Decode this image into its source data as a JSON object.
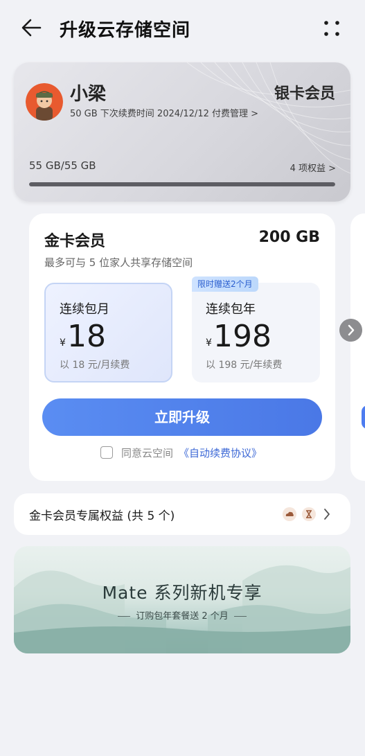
{
  "header": {
    "title": "升级云存储空间"
  },
  "member": {
    "name": "小梁",
    "tier": "银卡会员",
    "renew_info": "50 GB 下次续费时间 2024/12/12 付费管理 >",
    "usage": "55 GB/55 GB",
    "usage_fraction": 1.0,
    "benefits_link": "4 项权益 >"
  },
  "plan": {
    "title": "金卡会员",
    "size": "200 GB",
    "subtitle": "最多可与 5 位家人共享存储空间",
    "options": [
      {
        "name": "连续包月",
        "currency": "¥",
        "price": "18",
        "note": "以 18 元/月续费",
        "selected": true
      },
      {
        "name": "连续包年",
        "currency": "¥",
        "price": "198",
        "note": "以 198 元/年续费",
        "selected": false
      }
    ],
    "promo_badge": "限时赠送2个月",
    "upgrade_label": "立即升级",
    "agree_text": "同意云空间",
    "agreement_link": "《自动续费协议》"
  },
  "benefits": {
    "title": "金卡会员专属权益 (共 5 个)"
  },
  "banner": {
    "title": "Mate 系列新机专享",
    "subtitle": "订购包年套餐送 2 个月"
  },
  "colors": {
    "accent": "#4a78e6",
    "link": "#3c68d6",
    "background": "#f1f2f6"
  },
  "icons": [
    "back-arrow-icon",
    "more-dots-icon",
    "avatar-image",
    "chevron-right-icon",
    "benefit-cloud-icon",
    "benefit-hourglass-icon",
    "checkbox-icon"
  ]
}
